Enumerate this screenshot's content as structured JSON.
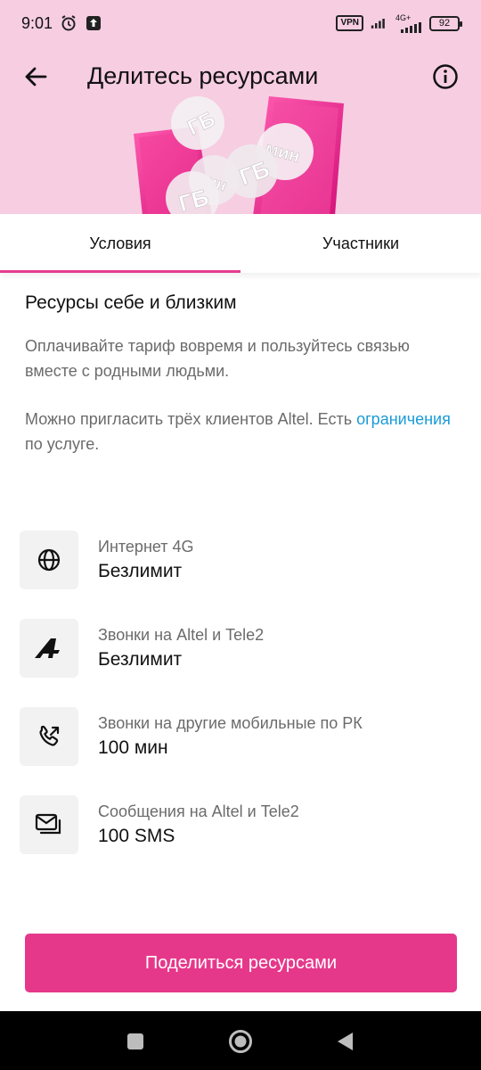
{
  "status_bar": {
    "time": "9:01",
    "vpn": "VPN",
    "network": "4G+",
    "battery": "92"
  },
  "header": {
    "title": "Делитесь ресурсами",
    "bubble_gb": "ГБ",
    "bubble_min": "мин"
  },
  "tabs": [
    {
      "label": "Условия",
      "active": true
    },
    {
      "label": "Участники",
      "active": false
    }
  ],
  "main": {
    "heading": "Ресурсы себе и близким",
    "description": "Оплачивайте тариф вовремя и пользуйтесь связью вместе с родными людьми.",
    "invite_text": "Можно пригласить трёх клиентов Altel. Есть",
    "invite_link": "ограничения",
    "invite_suffix": " по услуге."
  },
  "resources": [
    {
      "icon": "globe-icon",
      "label": "Интернет 4G",
      "value": "Безлимит"
    },
    {
      "icon": "altel-logo-icon",
      "label": "Звонки на Altel и Tele2",
      "value": "Безлимит"
    },
    {
      "icon": "phone-call-icon",
      "label": "Звонки на другие мобильные по РК",
      "value": "100 мин"
    },
    {
      "icon": "messages-icon",
      "label": "Сообщения на Altel и Tele2",
      "value": "100 SMS"
    }
  ],
  "cta": {
    "label": "Поделиться ресурсами"
  },
  "colors": {
    "accent": "#e6388b",
    "header_bg": "#f7cde2",
    "link": "#1a9bd7"
  }
}
